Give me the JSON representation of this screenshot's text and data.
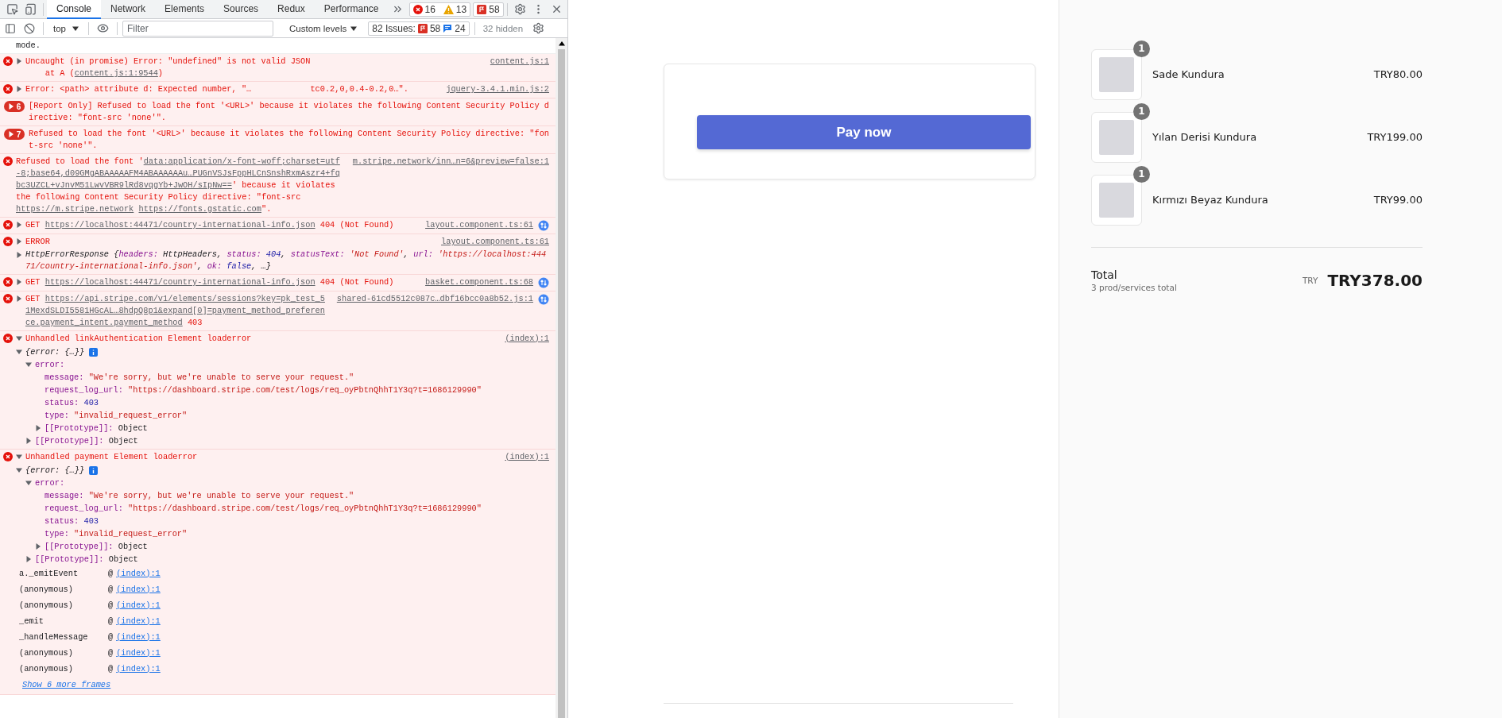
{
  "devtools": {
    "tabs": [
      {
        "label": "Console",
        "selected": true
      },
      {
        "label": "Network",
        "selected": false
      },
      {
        "label": "Elements",
        "selected": false
      },
      {
        "label": "Sources",
        "selected": false
      },
      {
        "label": "Redux",
        "selected": false
      },
      {
        "label": "Performance",
        "selected": false
      }
    ],
    "counters": {
      "errors": "16",
      "warnings": "13",
      "issues": "58"
    },
    "toolbar": {
      "context": "top",
      "filter_placeholder": "Filter",
      "levels": "Custom levels",
      "issues_label": "82 Issues:",
      "issues_errors": "58",
      "issues_info": "24",
      "hidden": "32 hidden"
    },
    "messages": [
      {
        "error": false,
        "segments": [
          {
            "text": "mode."
          }
        ]
      },
      {
        "error": true,
        "expanded": false,
        "segments": [
          {
            "text": "Uncaught (in promise) Error: \"undefined\" is not valid JSON\n    at A ("
          },
          {
            "text": "content.js:1:9544",
            "kind": "link"
          },
          {
            "text": ")"
          }
        ],
        "source": "content.js:1"
      },
      {
        "error": true,
        "expanded": false,
        "segments": [
          {
            "text": "Error: <path> attribute d: Expected number, \"…            tc0.2,0,0.4-0.2,0…\"."
          }
        ],
        "source": "jquery-3.4.1.min.js:2"
      },
      {
        "error": true,
        "count": "6",
        "segments": [
          {
            "text": "[Report Only] Refused to load the font '<URL>' because it violates the following Content Security Policy directive: \"font-src 'none'\"."
          }
        ]
      },
      {
        "error": true,
        "count": "7",
        "segments": [
          {
            "text": "Refused to load the font '<URL>' because it violates the following Content Security Policy directive: \"font-src 'none'\"."
          }
        ]
      },
      {
        "error": true,
        "segments": [
          {
            "text": "Refused to load the font '"
          },
          {
            "text": "data:application/x-font-woff;charset=utf-8;base64,d09GMgABAAAAAFM4ABAAAAAAu…PUGnVSJsFppHLCnSnshRxmAszr4+fqbc3UZCL+vJnvM51LwvVBR9lRd8vqgYb+JwOH/sIpNw==",
            "kind": "url"
          },
          {
            "text": "' because it violates the following Content Security Policy directive: \"font-src "
          },
          {
            "text": "https://m.stripe.network",
            "kind": "link"
          },
          {
            "text": "https://fonts.gstatic.com",
            "kind": "link"
          },
          {
            "text": "\"."
          }
        ],
        "source": "m.stripe.network/inn…n=6&preview=false:1"
      },
      {
        "error": true,
        "expanded": false,
        "segments": [
          {
            "text": "GET "
          },
          {
            "text": "https://localhost:44471/country-international-info.json",
            "kind": "link"
          },
          {
            "text": " 404 (Not Found)"
          }
        ],
        "source": "layout.component.ts:61",
        "network": true
      },
      {
        "error": true,
        "expanded": false,
        "segments": [
          {
            "text": "ERROR"
          }
        ],
        "source": "layout.component.ts:61",
        "object": {
          "expanded": false,
          "segments": [
            {
              "text": "HttpErrorResponse {"
            },
            {
              "text": "headers: ",
              "kind": "key"
            },
            {
              "text": "HttpHeaders, "
            },
            {
              "text": "status: ",
              "kind": "key"
            },
            {
              "text": "404",
              "kind": "number"
            },
            {
              "text": ", "
            },
            {
              "text": "statusText: ",
              "kind": "key"
            },
            {
              "text": "'Not Found'",
              "kind": "string"
            },
            {
              "text": ", "
            },
            {
              "text": "url: ",
              "kind": "key"
            },
            {
              "text": "'https://localhost:44471/country-international-info.json'",
              "kind": "string"
            },
            {
              "text": ", "
            },
            {
              "text": "ok: ",
              "kind": "key"
            },
            {
              "text": "false",
              "kind": "number"
            },
            {
              "text": ", …}"
            }
          ]
        }
      },
      {
        "error": true,
        "expanded": false,
        "segments": [
          {
            "text": "GET "
          },
          {
            "text": "https://localhost:44471/country-international-info.json",
            "kind": "link"
          },
          {
            "text": " 404 (Not Found)"
          }
        ],
        "source": "basket.component.ts:68",
        "network": true
      },
      {
        "error": true,
        "expanded": false,
        "segments": [
          {
            "text": "GET "
          },
          {
            "text": "https://api.stripe.com/v1/elements/sessions?key=pk_test_51MexdSLDI5581HGcAL…8hdpQ8p1&expand[0]=payment_method_preference.payment_intent.payment_method",
            "kind": "url"
          },
          {
            "text": " 403"
          }
        ],
        "source": "shared-61cd5512c087c…dbf16bcc0a8b52.js:1",
        "network": true
      },
      {
        "error": true,
        "expanded": true,
        "segments": [
          {
            "text": "Unhandled linkAuthentication Element loaderror"
          }
        ],
        "source": "(index):1",
        "tree": [
          {
            "preview": "{error: {…}}",
            "expanded": true,
            "info": true,
            "children": [
              {
                "key": "error:",
                "expanded": true,
                "children": [
                  {
                    "key": "message:",
                    "value": "\"We're sorry, but we're unable to serve your request.\"",
                    "kind": "string"
                  },
                  {
                    "key": "request_log_url:",
                    "value": "\"https://dashboard.stripe.com/test/logs/req_oyPbtnQhhT1Y3q?t=1686129990\"",
                    "kind": "string"
                  },
                  {
                    "key": "status:",
                    "value": "403",
                    "kind": "number"
                  },
                  {
                    "key": "type:",
                    "value": "\"invalid_request_error\"",
                    "kind": "string"
                  },
                  {
                    "key": "[[Prototype]]:",
                    "value": "Object",
                    "kind": "object",
                    "expanded": false
                  }
                ]
              },
              {
                "key": "[[Prototype]]:",
                "value": "Object",
                "kind": "object",
                "expanded": false
              }
            ]
          }
        ]
      },
      {
        "error": true,
        "expanded": true,
        "segments": [
          {
            "text": "Unhandled payment Element loaderror"
          }
        ],
        "source": "(index):1",
        "tree": [
          {
            "preview": "{error: {…}}",
            "expanded": true,
            "info": true,
            "children": [
              {
                "key": "error:",
                "expanded": true,
                "children": [
                  {
                    "key": "message:",
                    "value": "\"We're sorry, but we're unable to serve your request.\"",
                    "kind": "string"
                  },
                  {
                    "key": "request_log_url:",
                    "value": "\"https://dashboard.stripe.com/test/logs/req_oyPbtnQhhT1Y3q?t=1686129990\"",
                    "kind": "string"
                  },
                  {
                    "key": "status:",
                    "value": "403",
                    "kind": "number"
                  },
                  {
                    "key": "type:",
                    "value": "\"invalid_request_error\"",
                    "kind": "string"
                  },
                  {
                    "key": "[[Prototype]]:",
                    "value": "Object",
                    "kind": "object",
                    "expanded": false
                  }
                ]
              },
              {
                "key": "[[Prototype]]:",
                "value": "Object",
                "kind": "object",
                "expanded": false
              }
            ]
          }
        ],
        "stack": [
          {
            "function": "a._emitEvent",
            "at": "@",
            "link": "(index):1"
          },
          {
            "function": "(anonymous)",
            "at": "@",
            "link": "(index):1"
          },
          {
            "function": "(anonymous)",
            "at": "@",
            "link": "(index):1"
          },
          {
            "function": "_emit",
            "at": "@",
            "link": "(index):1"
          },
          {
            "function": "_handleMessage",
            "at": "@",
            "link": "(index):1"
          },
          {
            "function": "(anonymous)",
            "at": "@",
            "link": "(index):1"
          },
          {
            "function": "(anonymous)",
            "at": "@",
            "link": "(index):1"
          }
        ],
        "more_frames": "Show 6 more frames"
      }
    ]
  },
  "checkout": {
    "pay_button": "Pay now"
  },
  "summary": {
    "items": [
      {
        "quantity": "1",
        "name": "Sade Kundura",
        "price": "TRY80.00"
      },
      {
        "quantity": "1",
        "name": "Yılan Derisi Kundura",
        "price": "TRY199.00"
      },
      {
        "quantity": "1",
        "name": "Kırmızı Beyaz Kundura",
        "price": "TRY99.00"
      }
    ],
    "total": {
      "label": "Total",
      "note": "3 prod/services total",
      "currency": "TRY",
      "amount": "TRY378.00"
    }
  }
}
